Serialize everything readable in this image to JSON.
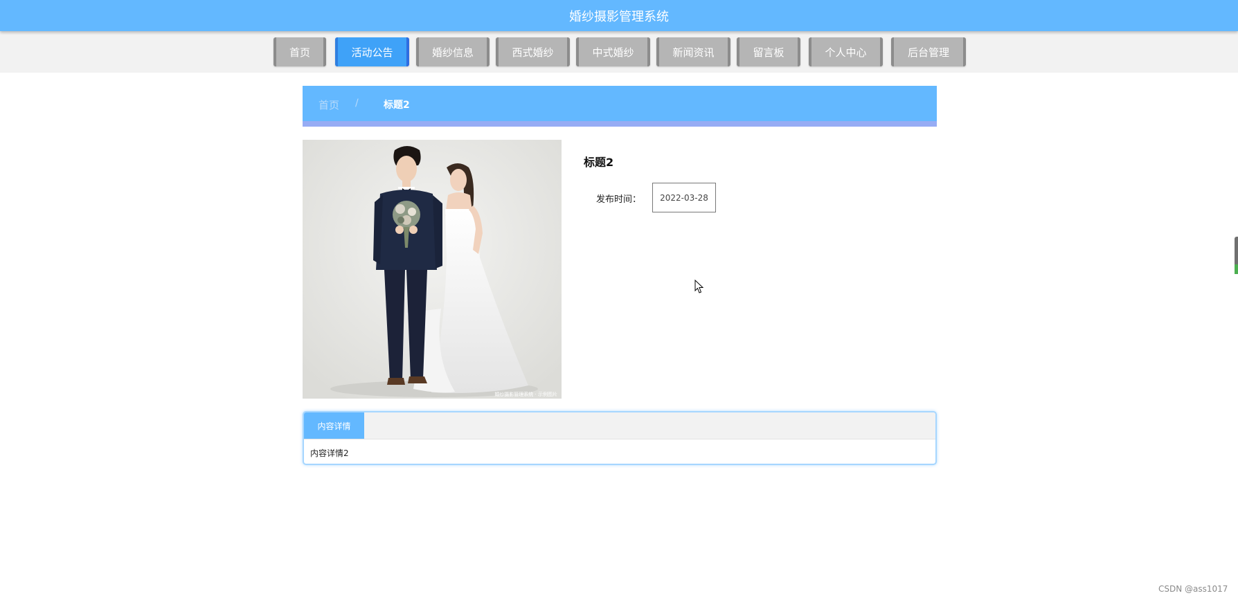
{
  "header": {
    "title": "婚纱摄影管理系统"
  },
  "nav": {
    "items": [
      {
        "label": "首页"
      },
      {
        "label": "活动公告",
        "active": true
      },
      {
        "label": "婚纱信息"
      },
      {
        "label": "西式婚纱"
      },
      {
        "label": "中式婚纱"
      },
      {
        "label": "新闻资讯"
      },
      {
        "label": "留言板"
      },
      {
        "label": "个人中心"
      },
      {
        "label": "后台管理"
      }
    ]
  },
  "breadcrumb": {
    "home": "首页",
    "separator": "/",
    "current": "标题2"
  },
  "detail": {
    "title": "标题2",
    "publish_label": "发布时间：",
    "publish_date": "2022-03-28",
    "photo_icon": "wedding-couple-photo",
    "photo_watermark": "婚纱摄影管理系统 · 示例图片"
  },
  "tabs": {
    "active_label": "内容详情",
    "content": "内容详情2"
  },
  "footer": {
    "watermark": "CSDN @ass1017"
  },
  "colors": {
    "header_bg": "#63b8ff",
    "nav_active": "#3fa2f8",
    "nav_default": "#b5b5b5",
    "breadcrumb_stripe": "#97acf4",
    "tab_border": "#a6d6ff"
  }
}
